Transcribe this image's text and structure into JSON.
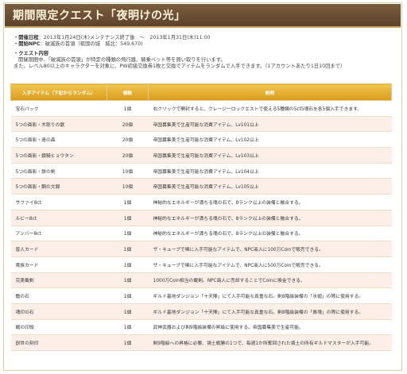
{
  "title": "期間限定クエスト「夜明けの光」",
  "info": {
    "period_label": "・開催日程",
    "period_value": "：2013年1月24日(木)メンテナンス終了後　～　2013年1月31日(木)11:00",
    "npc_label": "・開始NPC",
    "npc_value": "：破滅族の首領（祖国の城　城北：549,670)",
    "content_label": "・クエスト内容",
    "desc1": "開催期間中、「破滅族の首領」が特定の種類の飛行器、騎乗ペット等を買い取りを行います。",
    "desc2": "また、レベル80以上のキャラクターを対象に、PW初級交換券1枚と交換でアイテムをランダムで入手できます。（1アカウントあたり1日10回まで）"
  },
  "table": {
    "headers": [
      "入手アイテム（下記からランダム）",
      "個数",
      "説明"
    ],
    "rows": [
      {
        "item": "宝石パック",
        "qty": "1個",
        "desc": "右クリックで開封すると、クレージーロックエストで使える5種類の5ct5魂石を各5個入手できます。"
      },
      {
        "item": "5つの面影・木彫りの獣",
        "qty": "20個",
        "desc": "帝国募集美で生産可能な消費アイテム、Lv101以上"
      },
      {
        "item": "5つの面影・遠の森",
        "qty": "20個",
        "desc": "帝国募集美で生産可能な消費アイテム、Lv102以上"
      },
      {
        "item": "5つの面影・鏡騎ヒョウタン",
        "qty": "20個",
        "desc": "帝国募集美で生産可能な消費アイテム、Lv103以上"
      },
      {
        "item": "5つの面影・鉄の剣",
        "qty": "10個",
        "desc": "帝国募集美で生産可能な消費アイテム、Lv104以上"
      },
      {
        "item": "5つの面影・鋼の文録",
        "qty": "10個",
        "desc": "帝国募集美で生産可能な消費アイテム、Lv105以上"
      },
      {
        "item": "サファイ8ct",
        "qty": "1個",
        "desc": "神秘的なエネルギーが満ちる魂の石で、8ランク以上の装備と融合する。"
      },
      {
        "item": "ルビー8ct",
        "qty": "1個",
        "desc": "神秘的なエネルギーが満ちる魂の石で、8ランク以上の装備と融合する。"
      },
      {
        "item": "アンバー8ct",
        "qty": "1個",
        "desc": "神秘的なエネルギーが満ちる魂の石で、8ランク以上の装備と融合する。"
      },
      {
        "item": "普人カード",
        "qty": "1個",
        "desc": "ザ・キューブで稀に入手可能なアイテムで、NPC商人に100万Coinで販売できる。"
      },
      {
        "item": "貴族カード",
        "qty": "1個",
        "desc": "ザ・キューブで稀に入手可能なアイテムで、NPC商人に500万Coinで販売できる。"
      },
      {
        "item": "完美載剣",
        "qty": "1個",
        "desc": "1000万Coin相当の載剣。NPC商人に売却することでCoinに換金できる。"
      },
      {
        "item": "鑑の石",
        "qty": "1個",
        "desc": "ギルド基地ダンジョン「十天陣」にて入手可能な真重な石。剣8階級装備の「氷翅」の際に使用する。"
      },
      {
        "item": "魂印の石",
        "qty": "1個",
        "desc": "ギルド基地ダンジョン「十天陣」にて入手可能な真重な石。剣8階級装備の「鼻魂」の際に使用する。"
      },
      {
        "item": "戦の印綬",
        "qty": "1個",
        "desc": "武神武器および剣9階級装備の昇級に使用する。帝国募集美で生産可能。"
      },
      {
        "item": "創世の刻印",
        "qty": "1個",
        "desc": "剣9階級への昇格に必要、領土戦勝の1つで、毎週1か所奪回された領土の所有ギルドマスターが入手可能。"
      }
    ]
  }
}
